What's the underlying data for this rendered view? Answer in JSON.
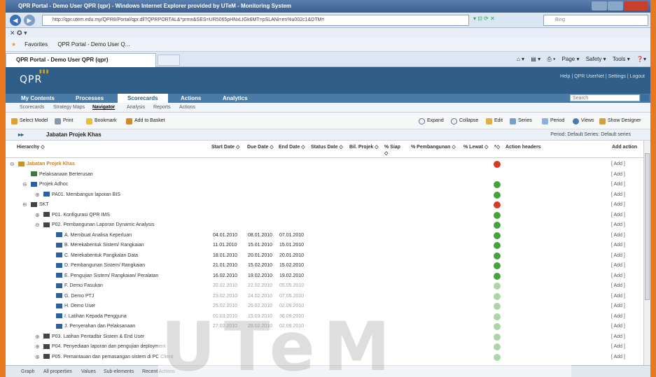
{
  "window": {
    "title": "QPR Portal - Demo User QPR (qpr) - Windows Internet Explorer provided by UTeM - Monitoring System"
  },
  "browser": {
    "url": "http://qpr.utem.edu.my/QPR8/Portal/qpr.dll?QPRPORTAL&*prmx&SES=UR5065pHNxLIGk6MT=pSLANi=en%u002c1&DTM=",
    "search_placeholder": "Bing",
    "menu_text": "✕  ✪ ▾",
    "favorites_label": "Favorites",
    "fav_item": "QPR Portal - Demo User Q...",
    "tab_label": "QPR Portal - Demo User QPR (qpr)",
    "tools": [
      "Page ▾",
      "Safety ▾",
      "Tools ▾"
    ]
  },
  "app": {
    "logo": "QPR",
    "header_links": "Help  |  QPR UserNet  |  Settings  |  Logout",
    "main_nav": [
      "My Contents",
      "Processes",
      "Scorecards",
      "Actions",
      "Analytics"
    ],
    "search_placeholder": "Search",
    "sub_nav": [
      "Scorecards",
      "Strategy Maps",
      "Navigator",
      "Analysis",
      "Reports",
      "Actions"
    ],
    "toolbar_left": [
      "Select Model",
      "Print",
      "Bookmark",
      "Add to Basket"
    ],
    "toolbar_right": [
      "Expand",
      "Collapse",
      "Edit",
      "Series",
      "Period",
      "Views",
      "Show Designer"
    ],
    "title_row": "Jabatan Projek Khas",
    "period": "Period: Default   Series: Default series"
  },
  "grid": {
    "columns": [
      "Hierarchy ◇",
      "Start Date ◇",
      "Due Date ◇",
      "End Date ◇",
      "Status Date ◇",
      "Bil. Projek ◇",
      "% Siap ◇",
      "% Pembangunan ◇",
      "% Lewat ◇",
      "*◇",
      "Action headers",
      "Add action"
    ],
    "add_label": "[ Add ]",
    "rows": [
      {
        "name": "Jabatan Projek Khas",
        "start": "",
        "due": "",
        "end": "",
        "status": "red"
      },
      {
        "name": "Pelaksanaan Berterusan",
        "start": "",
        "due": "",
        "end": "",
        "status": ""
      },
      {
        "name": "Projek Adhoc",
        "start": "",
        "due": "",
        "end": "",
        "status": "green"
      },
      {
        "name": "PA01. Membangun laporan BIS",
        "start": "",
        "due": "",
        "end": "",
        "status": "green"
      },
      {
        "name": "SKT",
        "start": "",
        "due": "",
        "end": "",
        "status": "red"
      },
      {
        "name": "P01. Konfigurasi QPR IMS",
        "start": "",
        "due": "",
        "end": "",
        "status": "green"
      },
      {
        "name": "P02. Pembangunan Laporan Dynamic Analysis",
        "start": "",
        "due": "",
        "end": "",
        "status": "green"
      },
      {
        "name": "A. Membuat Analisa Keperluan",
        "start": "04.01.2010",
        "due": "08.01.2010",
        "end": "07.01.2010",
        "status": "green"
      },
      {
        "name": "B. Merekabentuk Sistem/ Rangkaian",
        "start": "11.01.2010",
        "due": "15.01.2010",
        "end": "15.01.2010",
        "status": "green"
      },
      {
        "name": "C. Merekabentuk Pangkalan Data",
        "start": "18.01.2010",
        "due": "20.01.2010",
        "end": "20.01.2010",
        "status": "green"
      },
      {
        "name": "D. Pembangunan Sistem/ Rangkaian",
        "start": "21.01.2010",
        "due": "15.02.2010",
        "end": "15.02.2010",
        "status": "green"
      },
      {
        "name": "E. Pengujian Sistem/ Rangkaian/ Peralatan",
        "start": "16.02.2010",
        "due": "19.02.2010",
        "end": "19.02.2010",
        "status": "green"
      },
      {
        "name": "F. Demo Fasukan",
        "start": "20.02.2010",
        "due": "22.02.2010",
        "end": "05.05.2010",
        "status": "green"
      },
      {
        "name": "G. Demo PTJ",
        "start": "23.02.2010",
        "due": "24.02.2010",
        "end": "07.05.2010",
        "status": "green"
      },
      {
        "name": "H. Demo User",
        "start": "25.02.2010",
        "due": "26.02.2010",
        "end": "02.09.2010",
        "status": "green"
      },
      {
        "name": "I. Latihan Kepada Pengguna",
        "start": "01.03.2010",
        "due": "15.03.2010",
        "end": "30.09.2010",
        "status": "green"
      },
      {
        "name": "J. Penyerahan dan Pelaksanaan",
        "start": "27.02.2010",
        "due": "28.02.2010",
        "end": "02.09.2010",
        "status": "green"
      },
      {
        "name": "P03. Latihan Pentadbir Sistem & End User",
        "start": "",
        "due": "",
        "end": "",
        "status": "green"
      },
      {
        "name": "P04. Penyediaan laporan dan pengujian deployment",
        "start": "",
        "due": "",
        "end": "",
        "status": "green"
      },
      {
        "name": "P05. Pemantauan dan pemasangan sistem di PC Client",
        "start": "",
        "due": "",
        "end": "",
        "status": "green"
      }
    ]
  },
  "bottom_tabs": [
    "Graph",
    "All properties",
    "Values",
    "Sub-elements",
    "Recent Actions"
  ],
  "watermark": "UTeM",
  "colors": {
    "header": "#2f5f88",
    "nav": "#4a7aa6",
    "green": "#46a33c",
    "red": "#d63a28",
    "accent": "#e8781e"
  }
}
